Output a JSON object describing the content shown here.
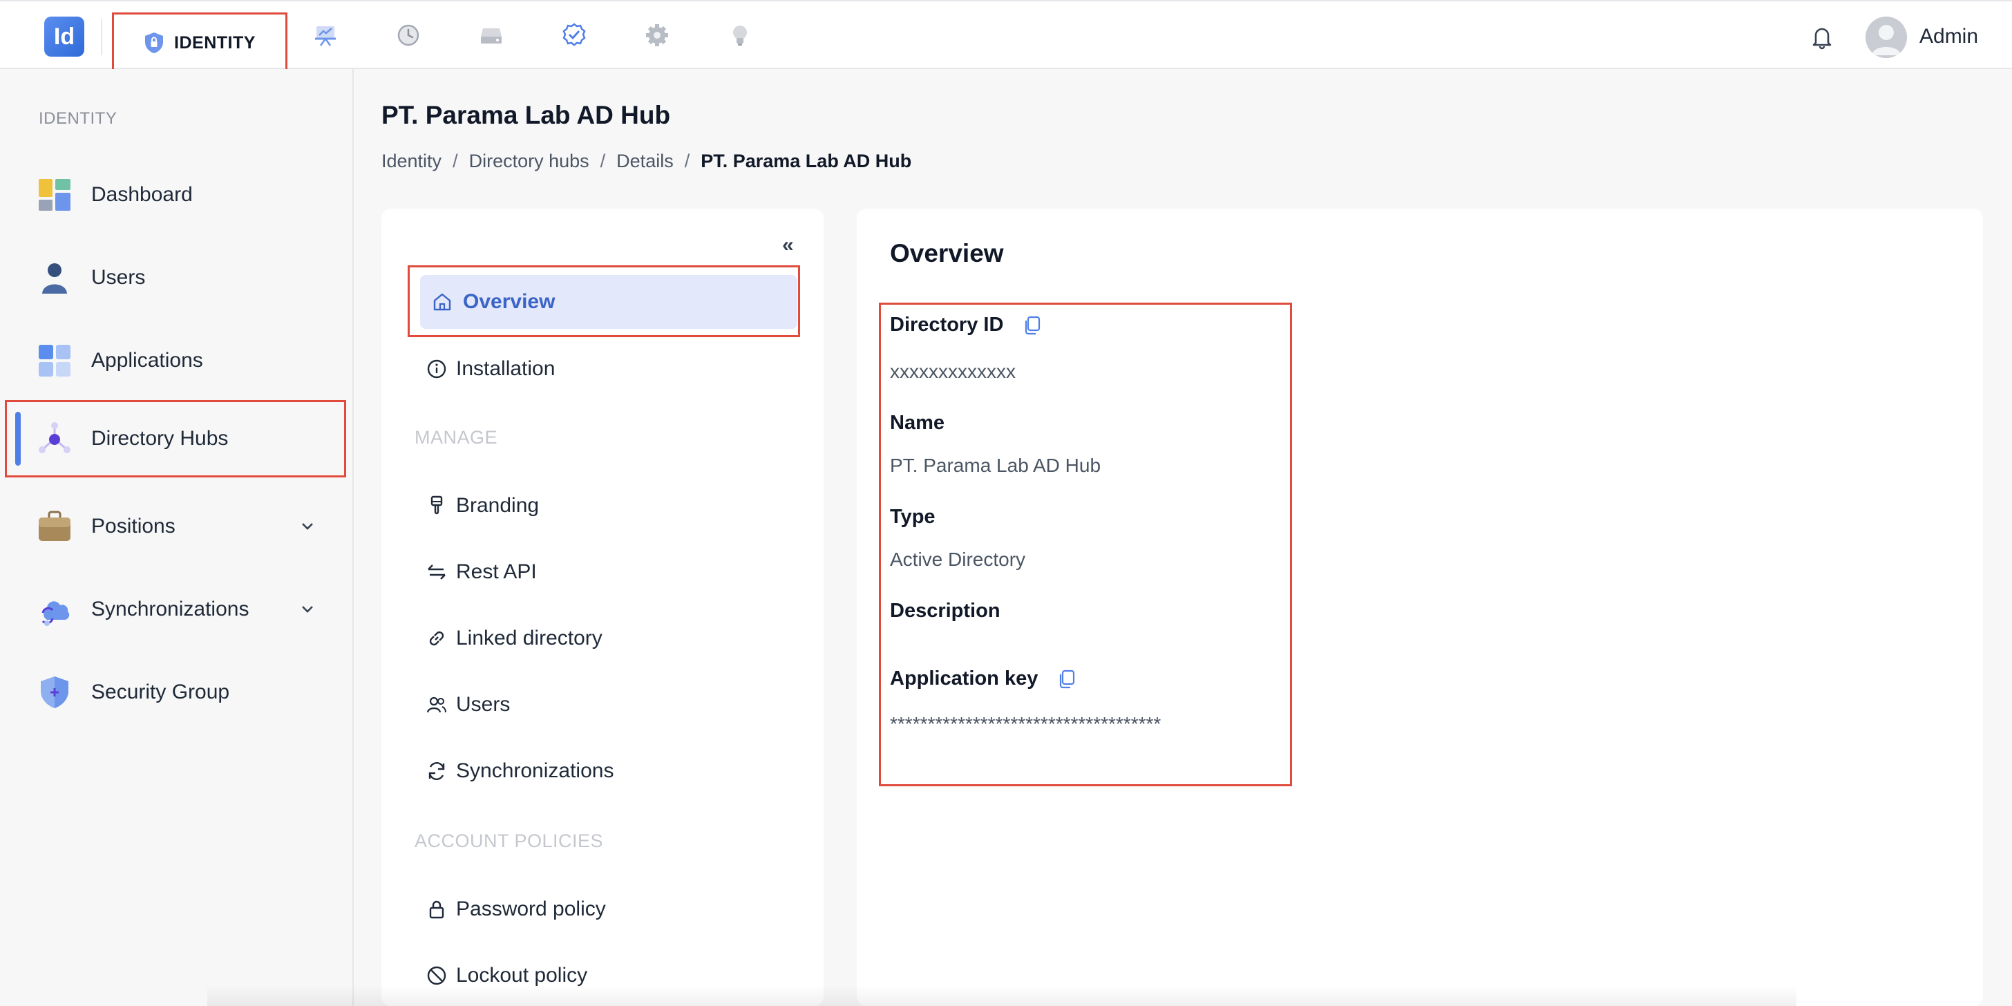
{
  "app": {
    "logo_text": "Id",
    "user_name": "Admin"
  },
  "topnav": {
    "active_tab_label": "IDENTITY",
    "icons": [
      "shield-icon",
      "presentation-icon",
      "history-icon",
      "storage-icon",
      "check-badge-icon",
      "gear-icon",
      "lightbulb-icon",
      "bell-icon"
    ]
  },
  "sidebar": {
    "section": "IDENTITY",
    "items": [
      {
        "label": "Dashboard",
        "icon": "dashboard-icon"
      },
      {
        "label": "Users",
        "icon": "user-icon"
      },
      {
        "label": "Applications",
        "icon": "applications-icon"
      },
      {
        "label": "Directory Hubs",
        "icon": "hub-icon",
        "active": true
      },
      {
        "label": "Positions",
        "icon": "briefcase-icon",
        "expandable": true
      },
      {
        "label": "Synchronizations",
        "icon": "cloud-sync-icon",
        "expandable": true
      },
      {
        "label": "Security Group",
        "icon": "shield-plus-icon"
      }
    ]
  },
  "page": {
    "title": "PT. Parama Lab AD Hub",
    "breadcrumb": [
      "Identity",
      "Directory hubs",
      "Details",
      "PT. Parama Lab AD Hub"
    ],
    "breadcrumb_sep": "/"
  },
  "submenu": {
    "collapse_label": "«",
    "items": [
      {
        "label": "Overview",
        "icon": "home-icon",
        "active": true
      },
      {
        "label": "Installation",
        "icon": "info-icon"
      }
    ],
    "manage_section": "MANAGE",
    "manage_items": [
      {
        "label": "Branding",
        "icon": "brush-icon"
      },
      {
        "label": "Rest API",
        "icon": "arrows-icon"
      },
      {
        "label": "Linked directory",
        "icon": "link-icon"
      },
      {
        "label": "Users",
        "icon": "users-icon"
      },
      {
        "label": "Synchronizations",
        "icon": "sync-icon"
      }
    ],
    "policies_section": "ACCOUNT POLICIES",
    "policy_items": [
      {
        "label": "Password policy",
        "icon": "lock-icon"
      },
      {
        "label": "Lockout policy",
        "icon": "ban-icon"
      }
    ]
  },
  "overview": {
    "title": "Overview",
    "directory_id_label": "Directory ID",
    "directory_id_value": "xxxxxxxxxxxxx",
    "name_label": "Name",
    "name_value": "PT. Parama Lab AD Hub",
    "type_label": "Type",
    "type_value": "Active Directory",
    "description_label": "Description",
    "description_value": "",
    "app_key_label": "Application key",
    "app_key_value": "************************************"
  },
  "colors": {
    "accent": "#3a64c8",
    "highlight_border": "#e04b3c",
    "active_bg": "#e3e8fb"
  }
}
